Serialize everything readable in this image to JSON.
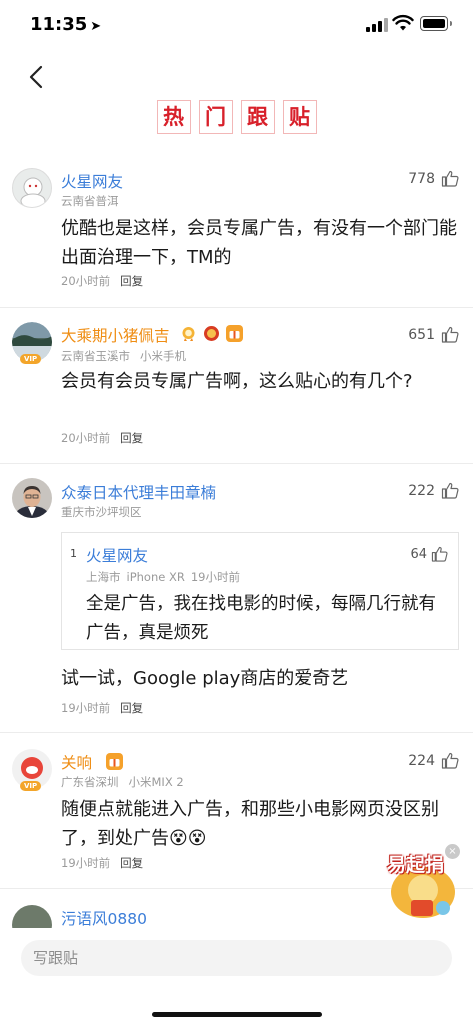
{
  "status_bar": {
    "time": "11:35",
    "location_glyph": "➤"
  },
  "header": {
    "back_icon": "chevron-left-icon",
    "title_chars": [
      "热",
      "门",
      "跟",
      "贴"
    ]
  },
  "comments": [
    {
      "name": "火星网友",
      "location": "云南省普洱",
      "device": "",
      "likes": "778",
      "content": "优酷也是这样，会员专属广告，有没有一个部门能出面治理一下，TM的",
      "time": "20小时前",
      "reply_label": "回复"
    },
    {
      "name": "大乘期小猪佩吉",
      "location": "云南省玉溪市",
      "device": "小米手机",
      "likes": "651",
      "content": "会员有会员专属广告啊，这么贴心的有几个?",
      "time": "20小时前",
      "reply_label": "回复",
      "vip": "VIP"
    },
    {
      "name": "众泰日本代理丰田章楠",
      "location": "重庆市沙坪坝区",
      "likes": "222",
      "quote": {
        "index": "1",
        "name": "火星网友",
        "location": "上海市",
        "device": "iPhone XR",
        "time": "19小时前",
        "likes": "64",
        "content": "全是广告，我在找电影的时候，每隔几行就有广告，真是烦死"
      },
      "content": "试一试，Google play商店的爱奇艺",
      "time": "19小时前",
      "reply_label": "回复"
    },
    {
      "name": "关响",
      "location": "广东省深圳",
      "device": "小米MIX 2",
      "likes": "224",
      "content": "随便点就能进入广告，和那些小电影网页没区别了，到处广告😵😵",
      "time": "19小时前",
      "reply_label": "回复",
      "vip": "VIP"
    },
    {
      "name": "污语风0880"
    }
  ],
  "bottom_bar": {
    "placeholder": "写跟贴"
  },
  "promo": {
    "text": "易起捐",
    "close_glyph": "×"
  },
  "colors": {
    "username_blue": "#3b7dd8",
    "username_gold": "#ef8d13",
    "title_red": "#d8202a"
  }
}
